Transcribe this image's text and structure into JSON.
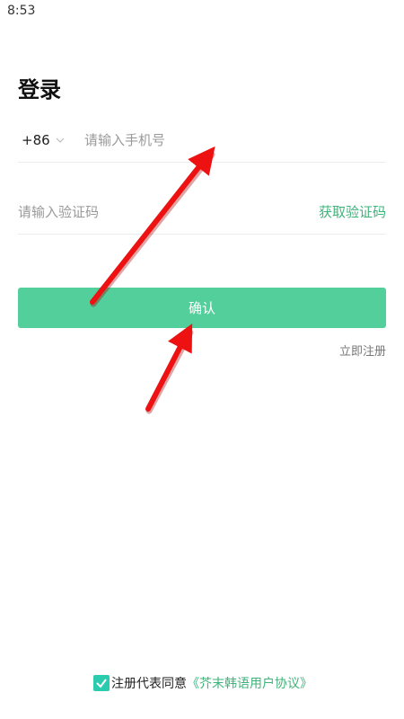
{
  "status_bar": {
    "time": "8:53"
  },
  "page": {
    "title": "登录"
  },
  "phone": {
    "country_code": "+86",
    "placeholder": "请输入手机号",
    "value": ""
  },
  "code": {
    "placeholder": "请输入验证码",
    "value": "",
    "get_code_label": "获取验证码"
  },
  "confirm_label": "确认",
  "register_label": "立即注册",
  "agreement": {
    "checked": true,
    "text": "注册代表同意",
    "link": "《芥末韩语用户协议》"
  },
  "colors": {
    "accent": "#52cf9b",
    "link_green": "#3fb37a",
    "checkbox": "#2bcbb0",
    "annotation_arrow": "#ee1111"
  },
  "annotations": {
    "icon": "red-arrow-icon",
    "count": 2
  }
}
